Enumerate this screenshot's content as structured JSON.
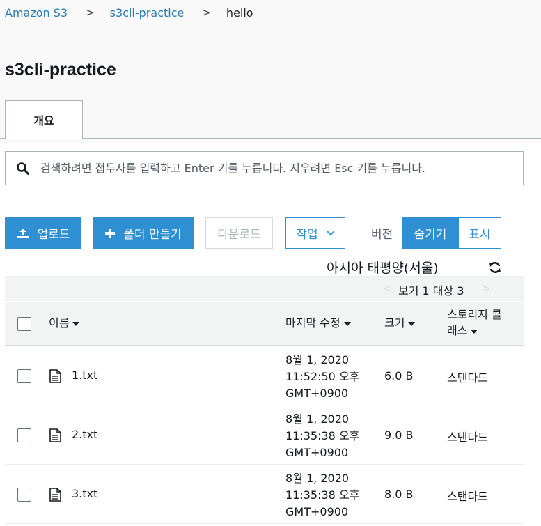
{
  "breadcrumb": {
    "root": "Amazon S3",
    "bucket": "s3cli-practice",
    "current": "hello"
  },
  "page": {
    "title": "s3cli-practice"
  },
  "tabs": [
    {
      "label": "개요"
    }
  ],
  "search": {
    "placeholder": "검색하려면 접두사를 입력하고 Enter 키를 누릅니다. 지우려면 Esc 키를 누릅니다."
  },
  "toolbar": {
    "upload": "업로드",
    "create_folder": "폴더 만들기",
    "download": "다운로드",
    "actions": "작업",
    "version_label": "버전",
    "hide": "숨기기",
    "show": "표시"
  },
  "region": "아시아 태평양(서울)",
  "pagination": {
    "text": "보기 1 대상 3"
  },
  "table": {
    "headers": {
      "name": "이름",
      "modified": "마지막 수정",
      "size": "크기",
      "storage_line1": "스토리지 클",
      "storage_line2": "래스"
    },
    "rows": [
      {
        "name": "1.txt",
        "modified_date": "8월 1, 2020",
        "modified_time": "11:52:50 오후",
        "modified_tz": "GMT+0900",
        "size": "6.0 B",
        "storage_class": "스탠다드"
      },
      {
        "name": "2.txt",
        "modified_date": "8월 1, 2020",
        "modified_time": "11:35:38 오후",
        "modified_tz": "GMT+0900",
        "size": "9.0 B",
        "storage_class": "스탠다드"
      },
      {
        "name": "3.txt",
        "modified_date": "8월 1, 2020",
        "modified_time": "11:35:38 오후",
        "modified_tz": "GMT+0900",
        "size": "8.0 B",
        "storage_class": "스탠다드"
      }
    ]
  },
  "colors": {
    "accent": "#2e8fd3",
    "link": "#2a7bb0",
    "border": "#aab7b8"
  },
  "icons": {
    "upload": "upload-icon",
    "plus": "plus-icon",
    "search": "search-icon",
    "refresh": "refresh-icon",
    "file": "file-icon",
    "chevron": "chevron-down-icon"
  }
}
